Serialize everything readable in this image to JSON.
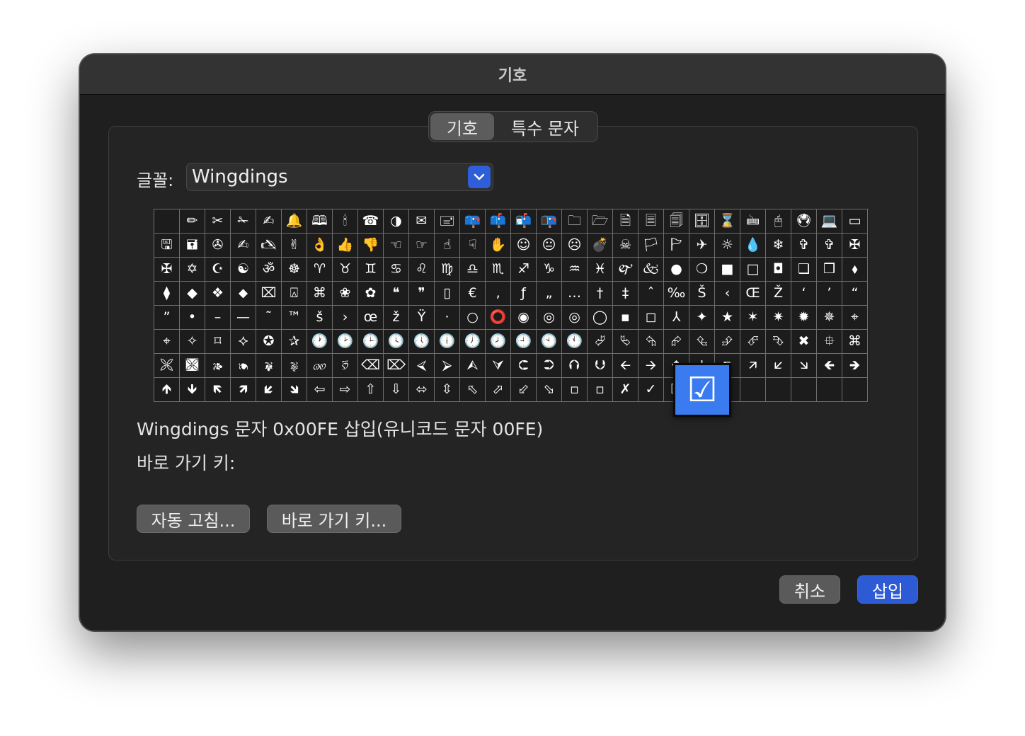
{
  "window": {
    "title": "기호"
  },
  "tabs": [
    {
      "label": "기호",
      "selected": true
    },
    {
      "label": "특수 문자",
      "selected": false
    }
  ],
  "font": {
    "label": "글꼴:",
    "value": "Wingdings"
  },
  "symbols": [
    "",
    "✏",
    "✂",
    "✁",
    "✍",
    "🔔",
    "🕮",
    "🕯",
    "☎",
    "◑",
    "✉",
    "🖃",
    "📪",
    "📫",
    "📬",
    "📭",
    "🗀",
    "🗁",
    "🗎",
    "🗏",
    "🗐",
    "🗄",
    "⌛",
    "🖮",
    "🖰",
    "🖲",
    "💻",
    "▭",
    "🖫",
    "🖬",
    "✇",
    "✍",
    "🖎",
    "✌",
    "👌",
    "👍",
    "👎",
    "☜",
    "☞",
    "☝",
    "☟",
    "✋",
    "☺",
    "😐",
    "☹",
    "💣",
    "☠",
    "🏳",
    "🏱",
    "✈",
    "☼",
    "💧",
    "❄",
    "✞",
    "✞",
    "✠",
    "✠",
    "✡",
    "☪",
    "☯",
    "ॐ",
    "☸",
    "♈",
    "♉",
    "♊",
    "♋",
    "♌",
    "♍",
    "♎",
    "♏",
    "♐",
    "♑",
    "♒",
    "♓",
    "🙰",
    "🙵",
    "●",
    "❍",
    "■",
    "□",
    "◘",
    "❑",
    "❒",
    "⬧",
    "⧫",
    "◆",
    "❖",
    "⬥",
    "⌧",
    "⍓",
    "⌘",
    "❀",
    "✿",
    "❝",
    "❞",
    "▯",
    "€",
    "‚",
    "ƒ",
    "„",
    "…",
    "†",
    "‡",
    "ˆ",
    "‰",
    "Š",
    "‹",
    "Œ",
    "Ž",
    "‘",
    "’",
    "“",
    "”",
    "•",
    "–",
    "—",
    "˜",
    "™",
    "š",
    "›",
    "œ",
    "ž",
    "Ÿ",
    "·",
    "○",
    "⭕",
    "◉",
    "◎",
    "◎",
    "◯",
    "▪",
    "◻",
    "⅄",
    "✦",
    "★",
    "✶",
    "✷",
    "✹",
    "✵",
    "⌖",
    "⌖",
    "✧",
    "⌑",
    "⯎",
    "✪",
    "✰",
    "🕐",
    "🕑",
    "🕒",
    "🕓",
    "🕔",
    "🕕",
    "🕖",
    "🕗",
    "🕘",
    "🕙",
    "🕚",
    "⮰",
    "⮱",
    "⮲",
    "⮳",
    "⮴",
    "⮵",
    "⮶",
    "⮷",
    "✖",
    "⯐",
    "⌘",
    "🙪",
    "🙫",
    "🙕",
    "🙔",
    "🙗",
    "🙖",
    "🙐",
    "🙑",
    "⌫",
    "⌦",
    "⮘",
    "⮚",
    "⮙",
    "⮛",
    "⮈",
    "⮊",
    "⮉",
    "⮋",
    "🡨",
    "🡪",
    "🡩",
    "🡫",
    "🡬",
    "🡭",
    "🡯",
    "🡮",
    "🡸",
    "🡺",
    "🡹",
    "🡻",
    "🡼",
    "🡽",
    "🡿",
    "🡾",
    "⇦",
    "⇨",
    "⇧",
    "⇩",
    "⬄",
    "⇳",
    "⬁",
    "⬀",
    "⬃",
    "⬂",
    "▫",
    "▫",
    "✗",
    "✓",
    "☒",
    "☑",
    "",
    "",
    "",
    "",
    "",
    ""
  ],
  "magnified_symbol": "☑",
  "description": "Wingdings 문자 0x00FE 삽입(유니코드 문자 00FE)",
  "shortcut_label": "바로 가기 키:",
  "buttons": {
    "autocorrect": "자동 고침...",
    "shortcut_key": "바로 가기 키...",
    "cancel": "취소",
    "insert": "삽입"
  },
  "colors": {
    "accent": "#2d5bd6",
    "magnifier": "#3b7bf0"
  }
}
